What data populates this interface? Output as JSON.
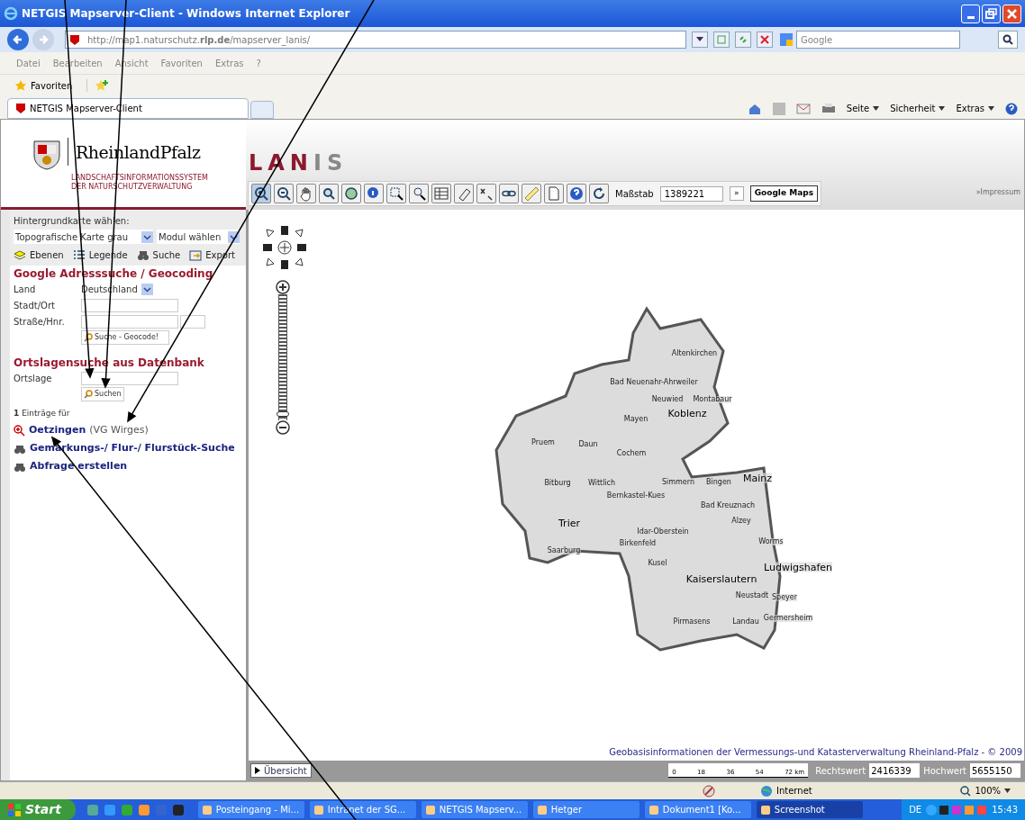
{
  "window": {
    "title": "NETGIS Mapserver-Client - Windows Internet Explorer"
  },
  "address_bar": {
    "url": "http://map1.naturschutz.**rlp.de**/mapserver_lanis/",
    "search_placeholder": "Google"
  },
  "menu": [
    "Datei",
    "Bearbeiten",
    "Ansicht",
    "Favoriten",
    "Extras",
    "?"
  ],
  "favorites_bar": {
    "label": "Favoriten"
  },
  "tabs": [
    {
      "label": "NETGIS Mapserver-Client",
      "selected": true
    }
  ],
  "command_bar": [
    "Seite",
    "Sicherheit",
    "Extras"
  ],
  "header": {
    "logo_text": "RheinlandPfalz",
    "subtitle": [
      "LANDSCHAFTSINFORMATIONSSYSTEM",
      "DER NATURSCHUTZVERWALTUNG"
    ],
    "app_title": [
      "LAN",
      "IS"
    ],
    "scale_label": "Maßstab",
    "scale_value": "1389221",
    "go_button": "»",
    "google_maps_button": "Google Maps",
    "impressum": "»Impressum"
  },
  "sidebar": {
    "background_label": "Hintergrundkarte wählen:",
    "background_select": "Topografische Karte grau",
    "module_select": "Modul wählen",
    "tabs": [
      {
        "label": "Ebenen"
      },
      {
        "label": "Legende"
      },
      {
        "label": "Suche"
      },
      {
        "label": "Export"
      }
    ],
    "geocoding": {
      "title": "Google Adresssuche / Geocoding",
      "land_label": "Land",
      "land_value": "Deutschland",
      "city_label": "Stadt/Ort",
      "street_label": "Straße/Hnr.",
      "button": "Suche - Geocode!"
    },
    "ortslage": {
      "title": "Ortslagensuche aus Datenbank",
      "label": "Ortslage",
      "button": "Suchen"
    },
    "results_count": "**1** Einträge für",
    "result": {
      "name": "Oetzingen",
      "detail": "(VG Wirges)"
    },
    "links": [
      "Gemarkungs-/ Flur-/ Flurstück-Suche",
      "Abfrage erstellen"
    ]
  },
  "map": {
    "zoom_slider": {
      "level": 0.03
    },
    "labels": [
      {
        "text": "Altenkirchen",
        "kind": "town"
      },
      {
        "text": "Bad Neuenahr-Ahrweiler",
        "kind": "town"
      },
      {
        "text": "Neuwied",
        "kind": "town"
      },
      {
        "text": "Montabaur",
        "kind": "town"
      },
      {
        "text": "Koblenz",
        "kind": "city"
      },
      {
        "text": "Mayen",
        "kind": "town"
      },
      {
        "text": "Pruem",
        "kind": "town"
      },
      {
        "text": "Daun",
        "kind": "town"
      },
      {
        "text": "Cochem",
        "kind": "town"
      },
      {
        "text": "Mainz",
        "kind": "city"
      },
      {
        "text": "Bitburg",
        "kind": "town"
      },
      {
        "text": "Wittlich",
        "kind": "town"
      },
      {
        "text": "Simmern",
        "kind": "town"
      },
      {
        "text": "Bingen",
        "kind": "town"
      },
      {
        "text": "Bernkastel-Kues",
        "kind": "town"
      },
      {
        "text": "Bad Kreuznach",
        "kind": "town"
      },
      {
        "text": "Trier",
        "kind": "city"
      },
      {
        "text": "Alzey",
        "kind": "town"
      },
      {
        "text": "Idar-Oberstein",
        "kind": "town"
      },
      {
        "text": "Birkenfeld",
        "kind": "town"
      },
      {
        "text": "Worms",
        "kind": "town"
      },
      {
        "text": "Saarburg",
        "kind": "town"
      },
      {
        "text": "Kusel",
        "kind": "town"
      },
      {
        "text": "Ludwigshafen",
        "kind": "city"
      },
      {
        "text": "Kaiserslautern",
        "kind": "city"
      },
      {
        "text": "Neustadt",
        "kind": "town"
      },
      {
        "text": "Speyer",
        "kind": "town"
      },
      {
        "text": "Germersheim",
        "kind": "town"
      },
      {
        "text": "Pirmasens",
        "kind": "town"
      },
      {
        "text": "Landau",
        "kind": "town"
      }
    ],
    "copyright": "Geobasisinformationen der Vermessungs-und Katasterverwaltung Rheinland-Pfalz - © 2009",
    "overview_button": "Übersicht",
    "scale_ticks": [
      "0",
      "18",
      "36",
      "54",
      "72"
    ],
    "scale_unit": "km",
    "easting_label": "Rechtswert",
    "easting": "2416339",
    "northing_label": "Hochwert",
    "northing": "5655150"
  },
  "status_bar": {
    "zone": "Internet",
    "zoom": "100%"
  },
  "taskbar": {
    "start": "Start",
    "tasks": [
      {
        "label": "Posteingang - Mi...",
        "selected": false
      },
      {
        "label": "Intranet der SG...",
        "selected": false
      },
      {
        "label": "NETGIS Mapserv...",
        "selected": false
      },
      {
        "label": "Hetger",
        "selected": false
      },
      {
        "label": "Dokument1 [Ko...",
        "selected": false
      },
      {
        "label": "Screenshot",
        "selected": true
      }
    ],
    "language": "DE",
    "clock": "15:43"
  }
}
